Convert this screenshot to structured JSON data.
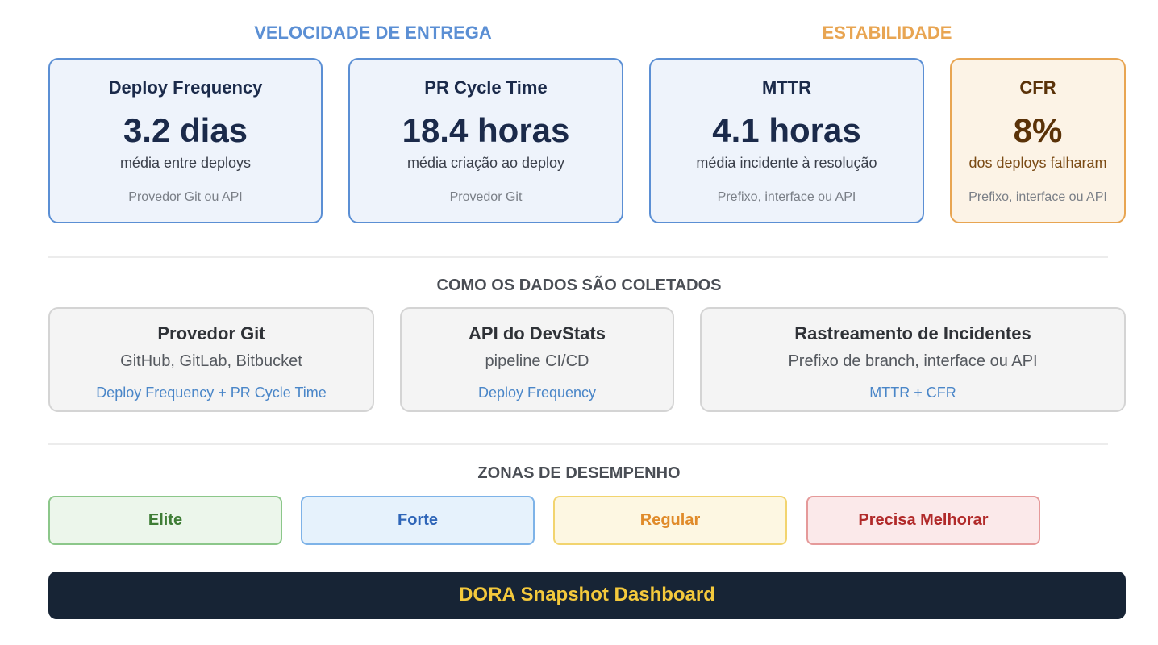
{
  "sections": {
    "velocity": "VELOCIDADE DE ENTREGA",
    "stability": "ESTABILIDADE",
    "collection": "COMO OS DADOS SÃO COLETADOS",
    "zones": "ZONAS DE DESEMPENHO"
  },
  "metrics": [
    {
      "title": "Deploy Frequency",
      "value": "3.2 dias",
      "subtitle": "média entre deploys",
      "source": "Provedor Git ou API"
    },
    {
      "title": "PR Cycle Time",
      "value": "18.4 horas",
      "subtitle": "média criação ao deploy",
      "source": "Provedor Git"
    },
    {
      "title": "MTTR",
      "value": "4.1 horas",
      "subtitle": "média incidente à resolução",
      "source": "Prefixo, interface ou API"
    },
    {
      "title": "CFR",
      "value": "8%",
      "subtitle": "dos deploys falharam",
      "source": "Prefixo, interface ou API"
    }
  ],
  "sources": [
    {
      "title": "Provedor Git",
      "subtitle": "GitHub, GitLab, Bitbucket",
      "metrics": "Deploy Frequency + PR Cycle Time"
    },
    {
      "title": "API do DevStats",
      "subtitle": "pipeline CI/CD",
      "metrics": "Deploy Frequency"
    },
    {
      "title": "Rastreamento de Incidentes",
      "subtitle": "Prefixo de branch, interface ou API",
      "metrics": "MTTR + CFR"
    }
  ],
  "zones": [
    {
      "label": "Elite"
    },
    {
      "label": "Forte"
    },
    {
      "label": "Regular"
    },
    {
      "label": "Precisa Melhorar"
    }
  ],
  "footer": "DORA Snapshot Dashboard",
  "colors": {
    "velocity_accent": "#5b8fd4",
    "stability_accent": "#e8a552",
    "footer_bg": "#172435",
    "footer_text": "#f4c93c"
  }
}
